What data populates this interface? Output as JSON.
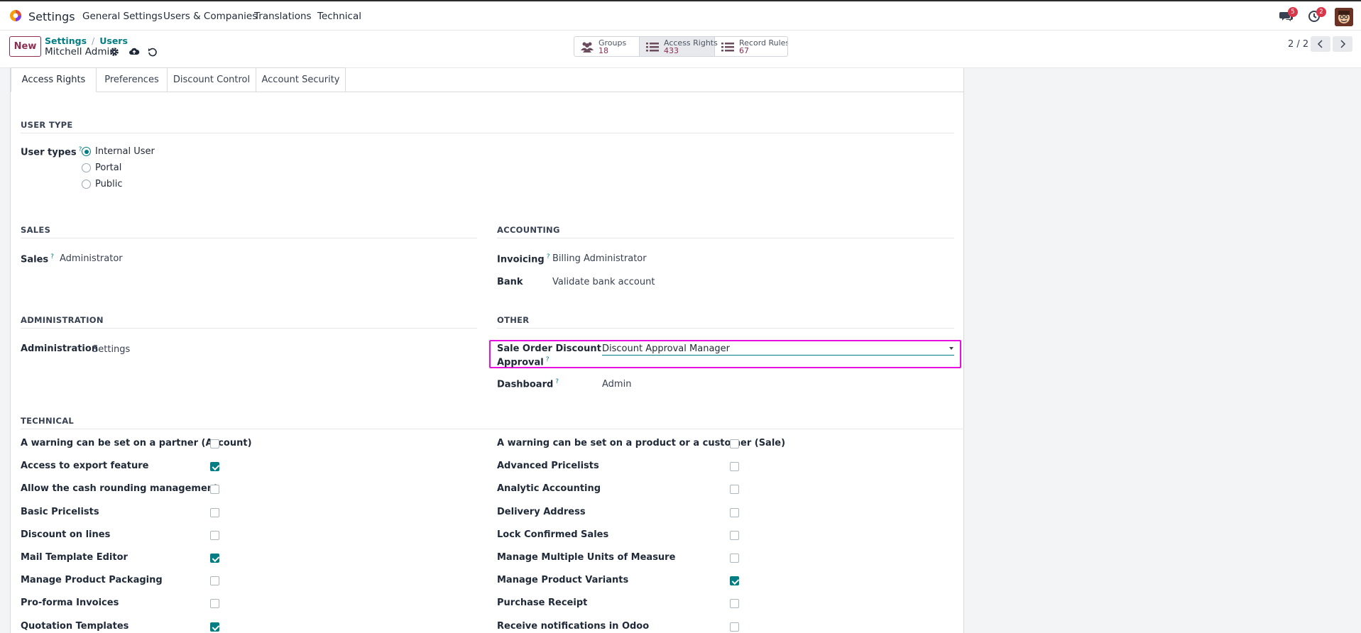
{
  "app": {
    "title": "Settings"
  },
  "nav": {
    "menus": [
      "General Settings",
      "Users & Companies",
      "Translations",
      "Technical"
    ],
    "messages_count": "5",
    "activities_count": "2"
  },
  "control_panel": {
    "new_label": "New",
    "breadcrumbs": [
      "Settings",
      "Users"
    ],
    "record_name": "Mitchell Admin",
    "stats": [
      {
        "label": "Groups",
        "count": "18",
        "icon": "users-icon"
      },
      {
        "label": "Access Rights",
        "count": "433",
        "icon": "list-icon"
      },
      {
        "label": "Record Rules",
        "count": "67",
        "icon": "list-icon"
      }
    ],
    "pager": "2 / 2"
  },
  "tabs": [
    "Access Rights",
    "Preferences",
    "Discount Control",
    "Account Security"
  ],
  "user_type": {
    "section": "USER TYPE",
    "label": "User types",
    "options": [
      "Internal User",
      "Portal",
      "Public"
    ],
    "selected": "Internal User"
  },
  "sales": {
    "section": "SALES",
    "label": "Sales",
    "value": "Administrator"
  },
  "accounting": {
    "section": "ACCOUNTING",
    "invoicing_label": "Invoicing",
    "invoicing_value": "Billing Administrator",
    "bank_label": "Bank",
    "bank_value": "Validate bank account"
  },
  "administration": {
    "section": "ADMINISTRATION",
    "label": "Administration",
    "value": "Settings"
  },
  "other": {
    "section": "OTHER",
    "discount_label_1": "Sale Order Discount",
    "discount_label_2": "Approval",
    "discount_value": "Discount Approval Manager",
    "dashboard_label": "Dashboard",
    "dashboard_value": "Admin"
  },
  "technical": {
    "section": "TECHNICAL",
    "left": [
      {
        "label": "A warning can be set on a partner (Account)",
        "checked": false
      },
      {
        "label": "Access to export feature",
        "checked": true
      },
      {
        "label": "Allow the cash rounding management",
        "checked": false
      },
      {
        "label": "Basic Pricelists",
        "checked": false
      },
      {
        "label": "Discount on lines",
        "checked": false
      },
      {
        "label": "Mail Template Editor",
        "checked": true
      },
      {
        "label": "Manage Product Packaging",
        "checked": false
      },
      {
        "label": "Pro-forma Invoices",
        "checked": false
      },
      {
        "label": "Quotation Templates",
        "checked": true
      }
    ],
    "right": [
      {
        "label": "A warning can be set on a product or a customer (Sale)",
        "checked": false
      },
      {
        "label": "Advanced Pricelists",
        "checked": false
      },
      {
        "label": "Analytic Accounting",
        "checked": false
      },
      {
        "label": "Delivery Address",
        "checked": false
      },
      {
        "label": "Lock Confirmed Sales",
        "checked": false
      },
      {
        "label": "Manage Multiple Units of Measure",
        "checked": false
      },
      {
        "label": "Manage Product Variants",
        "checked": true
      },
      {
        "label": "Purchase Receipt",
        "checked": false
      },
      {
        "label": "Receive notifications in Odoo",
        "checked": false
      }
    ]
  },
  "colors": {
    "brand": "#8c2d52",
    "accent": "#017e84",
    "highlight": "#e70fe0",
    "badge": "#d9364a"
  }
}
